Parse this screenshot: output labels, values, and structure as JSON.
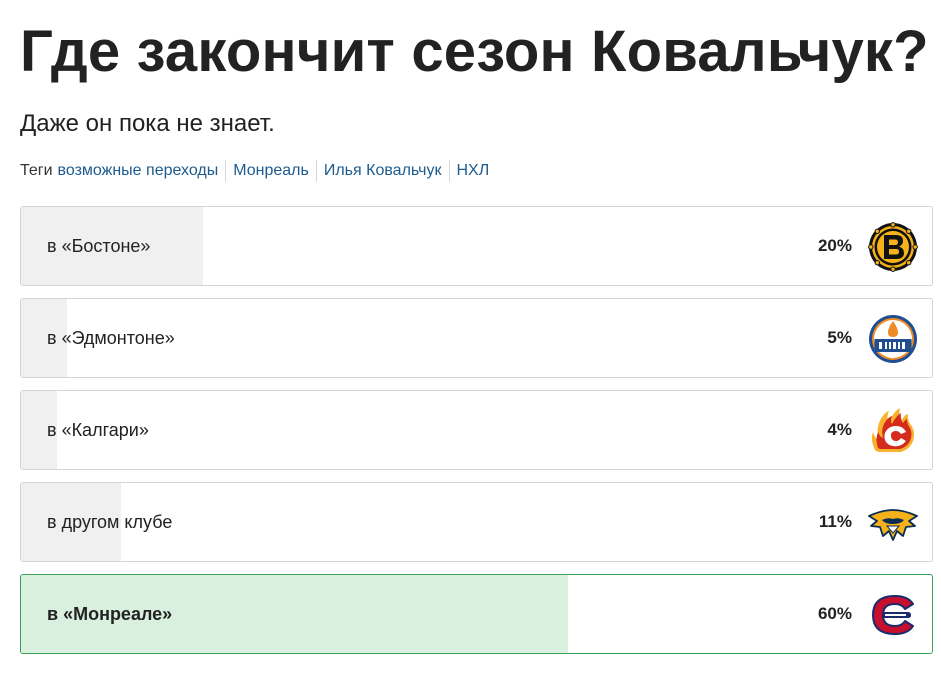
{
  "poll": {
    "title": "Где закончит сезон Ковальчук?",
    "subtitle": "Даже он пока не знает.",
    "tags_label": "Теги",
    "tags": [
      "возможные переходы",
      "Монреаль",
      "Илья Ковальчук",
      "НХЛ"
    ],
    "options": [
      {
        "label": "в «Бостоне»",
        "percent_text": "20%",
        "share": 0.2,
        "selected": false,
        "icon": "boston-bruins-logo-icon"
      },
      {
        "label": "в «Эдмонтоне»",
        "percent_text": "5%",
        "share": 0.05,
        "selected": false,
        "icon": "edmonton-oilers-logo-icon"
      },
      {
        "label": "в «Калгари»",
        "percent_text": "4%",
        "share": 0.04,
        "selected": false,
        "icon": "calgary-flames-logo-icon"
      },
      {
        "label": "в другом клубе",
        "percent_text": "11%",
        "share": 0.11,
        "selected": false,
        "icon": "nashville-predators-logo-icon"
      },
      {
        "label": "в «Монреале»",
        "percent_text": "60%",
        "share": 0.6,
        "selected": true,
        "icon": "montreal-canadiens-logo-icon"
      }
    ]
  },
  "colors": {
    "tag_link": "#1d5b8f",
    "bar_fill": "#f0f0f0",
    "selected_fill": "#d9f0df",
    "selected_border": "#3aa15a"
  }
}
